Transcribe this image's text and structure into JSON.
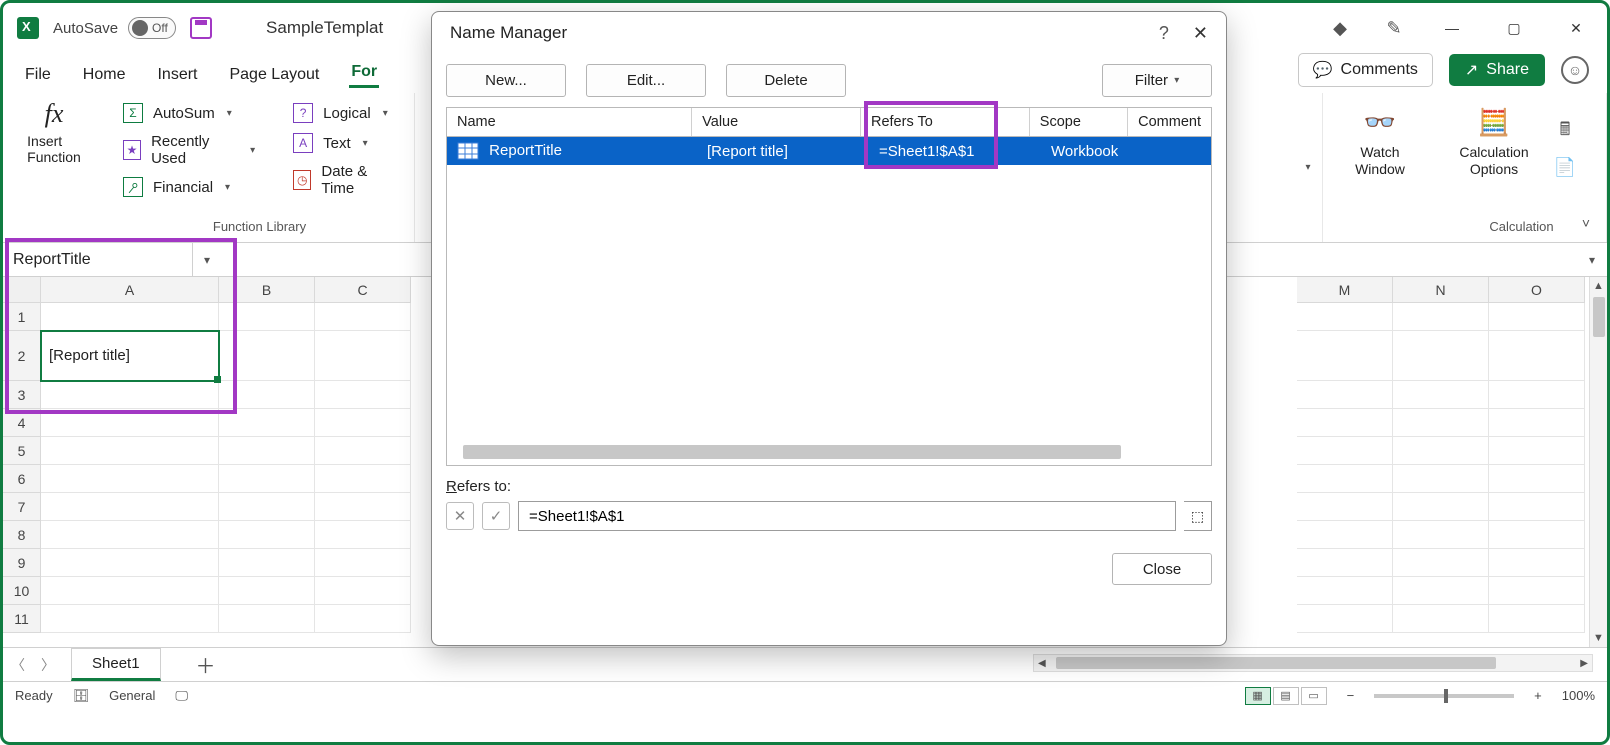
{
  "titlebar": {
    "autosave_label": "AutoSave",
    "autosave_state": "Off",
    "doc_name": "SampleTemplat"
  },
  "right_actions": {
    "comments": "Comments",
    "share": "Share"
  },
  "tabs": {
    "file": "File",
    "home": "Home",
    "insert": "Insert",
    "page_layout": "Page Layout",
    "formulas": "For"
  },
  "ribbon": {
    "insert_function": "Insert\nFunction",
    "autosum": "AutoSum",
    "recently_used": "Recently Used",
    "financial": "Financial",
    "logical": "Logical",
    "text": "Text",
    "date_time": "Date & Time",
    "group_function_library": "Function Library",
    "watch_window": "Watch\nWindow",
    "calc_options": "Calculation\nOptions",
    "group_calculation": "Calculation"
  },
  "namebox": "ReportTitle",
  "columns": [
    "A",
    "B",
    "C",
    "M",
    "N",
    "O"
  ],
  "row_count": 11,
  "cell_a2": "[Report title]",
  "sheet_tab": "Sheet1",
  "status": {
    "ready": "Ready",
    "general": "General",
    "zoom": "100%"
  },
  "name_manager": {
    "title": "Name Manager",
    "btn_new": "New...",
    "btn_edit": "Edit...",
    "btn_delete": "Delete",
    "btn_filter": "Filter",
    "hdr_name": "Name",
    "hdr_value": "Value",
    "hdr_refers": "Refers To",
    "hdr_scope": "Scope",
    "hdr_comment": "Comment",
    "row": {
      "name": "ReportTitle",
      "value": "[Report title]",
      "refers": "=Sheet1!$A$1",
      "scope": "Workbook",
      "comment": ""
    },
    "refersto_label": "Refers to:",
    "refersto_value": "=Sheet1!$A$1",
    "close": "Close"
  }
}
